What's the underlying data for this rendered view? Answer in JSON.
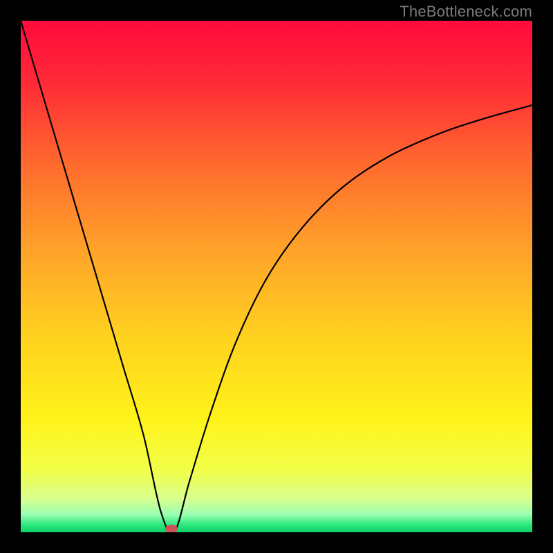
{
  "watermark": "TheBottleneck.com",
  "chart_data": {
    "type": "line",
    "title": "",
    "xlabel": "",
    "ylabel": "",
    "xlim": [
      0,
      100
    ],
    "ylim": [
      0,
      100
    ],
    "gradient_stops": [
      {
        "offset": 0,
        "color": "#ff0a3c"
      },
      {
        "offset": 0.12,
        "color": "#ff2a37"
      },
      {
        "offset": 0.28,
        "color": "#ff6a2e"
      },
      {
        "offset": 0.45,
        "color": "#ffa329"
      },
      {
        "offset": 0.62,
        "color": "#ffd21f"
      },
      {
        "offset": 0.78,
        "color": "#fff31a"
      },
      {
        "offset": 0.88,
        "color": "#f1ff4a"
      },
      {
        "offset": 0.935,
        "color": "#d8ff8f"
      },
      {
        "offset": 0.965,
        "color": "#9affb0"
      },
      {
        "offset": 0.985,
        "color": "#2fe87e"
      },
      {
        "offset": 1.0,
        "color": "#0ccf65"
      }
    ],
    "series": [
      {
        "name": "bottleneck-curve",
        "x": [
          0.0,
          4.0,
          8.0,
          12.0,
          16.0,
          20.0,
          24.0,
          27.4,
          30.0,
          33.0,
          37.0,
          42.0,
          48.0,
          55.0,
          63.0,
          72.0,
          82.0,
          91.0,
          100.0
        ],
        "y": [
          100.0,
          86.5,
          73.0,
          59.5,
          46.0,
          32.5,
          19.0,
          4.0,
          0.0,
          10.0,
          23.0,
          37.0,
          49.5,
          59.5,
          67.5,
          73.5,
          78.0,
          81.0,
          83.5
        ]
      }
    ],
    "marker": {
      "x": 29.5,
      "y": 0.7,
      "color": "#cf4f5a"
    }
  }
}
